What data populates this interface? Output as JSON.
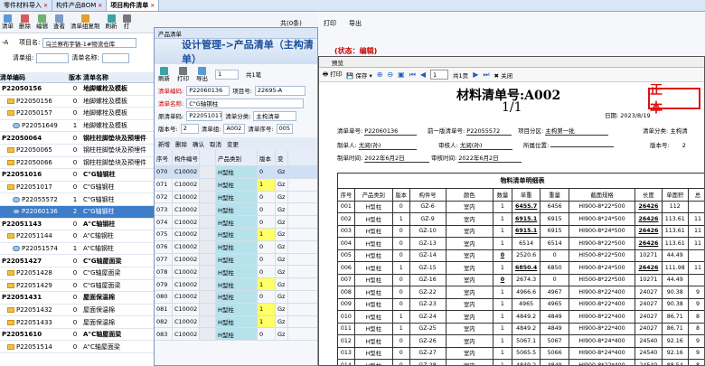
{
  "tabs": [
    {
      "label": "零件材料导入"
    },
    {
      "label": "构件产品BOM"
    },
    {
      "label": "项目构件清单"
    }
  ],
  "toolbar": {
    "items": [
      {
        "label": "清单"
      },
      {
        "label": "删除"
      },
      {
        "label": "编辑"
      },
      {
        "label": "查看"
      },
      {
        "label": "清单组复制"
      },
      {
        "label": "刷新"
      },
      {
        "label": "打"
      }
    ]
  },
  "top_right_text": {
    "a": "共(0条)",
    "b": "打印",
    "c": "导出",
    "d": "(状态：编辑)"
  },
  "filters": {
    "project_label": "项目名:",
    "project_value": "乌兰察布宇镐-1#物流仓库",
    "prefix": "-A",
    "list_group_label": "清单组:",
    "list_name_label": "清单名称:"
  },
  "tree": {
    "headers": [
      "清单编码",
      "版本",
      "清单名称"
    ],
    "rows": [
      {
        "code": "P22050156",
        "ver": "0",
        "name": "地脚螺栓及模板",
        "bold": true,
        "icon": "none"
      },
      {
        "code": "P22050156",
        "ver": "0",
        "name": "地脚螺栓及模板",
        "bold": false,
        "icon": "folder"
      },
      {
        "code": "P22050157",
        "ver": "0",
        "name": "地脚螺栓及模板",
        "bold": false,
        "icon": "folder"
      },
      {
        "code": "P22051649",
        "ver": "1",
        "name": "地脚螺栓及模板",
        "bold": false,
        "icon": "doc"
      },
      {
        "code": "P22050064",
        "ver": "0",
        "name": "钢柱柱脚垫块及预埋件",
        "bold": true,
        "icon": "none"
      },
      {
        "code": "P22050065",
        "ver": "0",
        "name": "钢柱柱脚垫块及预埋件",
        "bold": false,
        "icon": "folder"
      },
      {
        "code": "P22050066",
        "ver": "0",
        "name": "钢柱柱脚垫块及预埋件",
        "bold": false,
        "icon": "folder"
      },
      {
        "code": "P22051016",
        "ver": "0",
        "name": "C\"G轴钢柱",
        "bold": true,
        "icon": "none"
      },
      {
        "code": "P22051017",
        "ver": "0",
        "name": "C\"G轴钢柱",
        "bold": false,
        "icon": "folder"
      },
      {
        "code": "P22055572",
        "ver": "1",
        "name": "C\"G轴钢柱",
        "bold": false,
        "icon": "doc"
      },
      {
        "code": "P22060136",
        "ver": "2",
        "name": "C\"G轴钢柱",
        "bold": false,
        "icon": "doc",
        "selected": true
      },
      {
        "code": "P22051143",
        "ver": "0",
        "name": "A\"C轴钢柱",
        "bold": true,
        "icon": "none"
      },
      {
        "code": "P22051144",
        "ver": "0",
        "name": "A\"C轴钢柱",
        "bold": false,
        "icon": "folder"
      },
      {
        "code": "P22051574",
        "ver": "1",
        "name": "A\"C轴钢柱",
        "bold": false,
        "icon": "doc"
      },
      {
        "code": "P22051427",
        "ver": "0",
        "name": "C\"G轴屋面梁",
        "bold": true,
        "icon": "none"
      },
      {
        "code": "P22051428",
        "ver": "0",
        "name": "C\"G轴屋面梁",
        "bold": false,
        "icon": "folder"
      },
      {
        "code": "P22051429",
        "ver": "0",
        "name": "C\"G轴屋面梁",
        "bold": false,
        "icon": "folder"
      },
      {
        "code": "P22051431",
        "ver": "0",
        "name": "屋面保温棉",
        "bold": true,
        "icon": "none"
      },
      {
        "code": "P22051432",
        "ver": "0",
        "name": "屋面保温棉",
        "bold": false,
        "icon": "folder"
      },
      {
        "code": "P22051433",
        "ver": "0",
        "name": "屋面保温棉",
        "bold": false,
        "icon": "folder"
      },
      {
        "code": "P22051610",
        "ver": "0",
        "name": "A\"C轴屋面梁",
        "bold": true,
        "icon": "none"
      },
      {
        "code": "P22051514",
        "ver": "0",
        "name": "A\"C轴屋面梁",
        "bold": false,
        "icon": "folder"
      }
    ]
  },
  "mid": {
    "window_title": "产品清单",
    "heading": "设计管理->产品清单（主构清单）",
    "toolbar": {
      "refresh": "刷新",
      "print": "打印",
      "export": "导出",
      "page": "1",
      "total": "共1笔",
      "next": "浏览"
    },
    "fields": {
      "list_code_label": "清单编码:",
      "list_code": "P22060136",
      "project_label": "项目号:",
      "project": "22695-A",
      "list_name_label": "清单名称:",
      "list_name": "C\"G轴钢柱",
      "orig_label": "原清单码:",
      "orig": "P22051017",
      "cls_label": "清单分类:",
      "cls": "主构清单",
      "ver_label": "版本号:",
      "ver": "2",
      "group_label": "清单组:",
      "group": "A002",
      "seq_label": "清单序号:",
      "seq": "005"
    },
    "actions": [
      "新增",
      "删除",
      "确认",
      "取消",
      "变更"
    ],
    "grid_headers": [
      "序号",
      "构件编号",
      "产品类别",
      "版本",
      "变"
    ],
    "rows": [
      {
        "seq": "070",
        "code": "C10002",
        "cat": "H型柱",
        "ver": "0",
        "flag": "Gz"
      },
      {
        "seq": "071",
        "code": "C10002",
        "cat": "H型柱",
        "ver": "1",
        "flag": "Gz"
      },
      {
        "seq": "072",
        "code": "C10002",
        "cat": "H型柱",
        "ver": "0",
        "flag": "Gz"
      },
      {
        "seq": "073",
        "code": "C10002",
        "cat": "H型柱",
        "ver": "0",
        "flag": "Gz"
      },
      {
        "seq": "074",
        "code": "C10002",
        "cat": "H型柱",
        "ver": "0",
        "flag": "Gz"
      },
      {
        "seq": "075",
        "code": "C10002",
        "cat": "H型柱",
        "ver": "1",
        "flag": "Gz"
      },
      {
        "seq": "076",
        "code": "C10002",
        "cat": "H型柱",
        "ver": "0",
        "flag": "Gz"
      },
      {
        "seq": "077",
        "code": "C10002",
        "cat": "H型柱",
        "ver": "0",
        "flag": "Gz"
      },
      {
        "seq": "078",
        "code": "C10002",
        "cat": "H型柱",
        "ver": "0",
        "flag": "Gz"
      },
      {
        "seq": "079",
        "code": "C10002",
        "cat": "H型柱",
        "ver": "1",
        "flag": "Gz"
      },
      {
        "seq": "080",
        "code": "C10002",
        "cat": "H型柱",
        "ver": "0",
        "flag": "Gz"
      },
      {
        "seq": "081",
        "code": "C10002",
        "cat": "H型柱",
        "ver": "1",
        "flag": "Gz"
      },
      {
        "seq": "082",
        "code": "C10002",
        "cat": "H型柱",
        "ver": "1",
        "flag": "Gz"
      },
      {
        "seq": "083",
        "code": "C10002",
        "cat": "H型柱",
        "ver": "0",
        "flag": "Gz"
      }
    ]
  },
  "preview": {
    "window_title": "预览",
    "toolbar": {
      "print": "打印",
      "save": "保存",
      "page": "1",
      "total": "共1页",
      "close": "关闭"
    },
    "title": "材料清单号:A002",
    "page": "1/1",
    "stamp": "正 本",
    "date_label": "日期:",
    "date": "2023/8/19",
    "info": {
      "list_no_label": "清单单号:",
      "list_no": "P22060136",
      "prev_label": "前一版清单号:",
      "prev": "P22055572",
      "zone_label": "项目分区:",
      "zone": "主构第一批",
      "cls_label": "清单分类:",
      "cls": "主构清",
      "maker_label": "制单人:",
      "maker": "尤阅(孙)",
      "reviewer_label": "审核人:",
      "reviewer": "尤阅(孙)",
      "location_label": "所属位置:",
      "ver_label": "版本号:",
      "ver": "2",
      "made_time_label": "制单时间:",
      "made_time": "2022年6月2日",
      "review_time_label": "审核时间:",
      "review_time": "2022年6月2日"
    },
    "section": "物料清单明细表",
    "headers": [
      "序号",
      "产品类别",
      "版本",
      "构件号",
      "颜色",
      "数量",
      "单重",
      "重量",
      "截面规格",
      "长度",
      "单面积",
      "总"
    ],
    "rows": [
      {
        "n": "001",
        "cat": "H型柱",
        "ver": "0",
        "code": "GZ-6",
        "color": "室内",
        "qty": "1",
        "uw": "6455.7",
        "w": "6456",
        "spec": "HI900-8*22*500",
        "len": "26426",
        "area": "112",
        "t": "",
        "uwb": true,
        "lenb": true,
        "qtyb": false
      },
      {
        "n": "002",
        "cat": "H型柱",
        "ver": "1",
        "code": "GZ-9",
        "color": "室内",
        "qty": "1",
        "uw": "6915.1",
        "w": "6915",
        "spec": "HI900-8*24*500",
        "len": "26426",
        "area": "113.61",
        "t": "11",
        "uwb": true,
        "lenb": true,
        "qtyb": false
      },
      {
        "n": "003",
        "cat": "H型柱",
        "ver": "0",
        "code": "GZ-10",
        "color": "室内",
        "qty": "1",
        "uw": "6915.1",
        "w": "6915",
        "spec": "HI900-8*24*500",
        "len": "26426",
        "area": "113.61",
        "t": "11",
        "uwb": true,
        "lenb": true,
        "qtyb": false
      },
      {
        "n": "004",
        "cat": "H型柱",
        "ver": "0",
        "code": "GZ-13",
        "color": "室内",
        "qty": "1",
        "uw": "6514",
        "w": "6514",
        "spec": "HI900-8*22*500",
        "len": "26426",
        "area": "113.61",
        "t": "11",
        "uwb": false,
        "lenb": true,
        "qtyb": false
      },
      {
        "n": "005",
        "cat": "H型柱",
        "ver": "0",
        "code": "GZ-14",
        "color": "室内",
        "qty": "0",
        "uw": "2520.6",
        "w": "0",
        "spec": "HI500-8*22*500",
        "len": "10271",
        "area": "44.49",
        "t": "",
        "uwb": false,
        "lenb": false,
        "qtyb": true
      },
      {
        "n": "006",
        "cat": "H型柱",
        "ver": "1",
        "code": "GZ-15",
        "color": "室内",
        "qty": "1",
        "uw": "6850.4",
        "w": "6850",
        "spec": "HI900-8*24*500",
        "len": "26426",
        "area": "111.98",
        "t": "11",
        "uwb": true,
        "lenb": true,
        "qtyb": false
      },
      {
        "n": "007",
        "cat": "H型柱",
        "ver": "0",
        "code": "GZ-16",
        "color": "室内",
        "qty": "0",
        "uw": "2674.3",
        "w": "0",
        "spec": "HI500-8*22*500",
        "len": "10271",
        "area": "44.49",
        "t": "",
        "uwb": false,
        "lenb": false,
        "qtyb": true
      },
      {
        "n": "008",
        "cat": "H型柱",
        "ver": "0",
        "code": "GZ-22",
        "color": "室内",
        "qty": "1",
        "uw": "4966.6",
        "w": "4967",
        "spec": "HI900-8*22*400",
        "len": "24027",
        "area": "90.38",
        "t": "9",
        "uwb": false,
        "lenb": false,
        "qtyb": false
      },
      {
        "n": "009",
        "cat": "H型柱",
        "ver": "0",
        "code": "GZ-23",
        "color": "室内",
        "qty": "1",
        "uw": "4965",
        "w": "4965",
        "spec": "HI900-8*22*400",
        "len": "24027",
        "area": "90.38",
        "t": "9",
        "uwb": false,
        "lenb": false,
        "qtyb": false
      },
      {
        "n": "010",
        "cat": "H型柱",
        "ver": "1",
        "code": "GZ-24",
        "color": "室内",
        "qty": "1",
        "uw": "4849.2",
        "w": "4849",
        "spec": "HI900-8*22*400",
        "len": "24027",
        "area": "86.71",
        "t": "8",
        "uwb": false,
        "lenb": false,
        "qtyb": false
      },
      {
        "n": "011",
        "cat": "H型柱",
        "ver": "1",
        "code": "GZ-25",
        "color": "室内",
        "qty": "1",
        "uw": "4849.2",
        "w": "4849",
        "spec": "HI900-8*22*400",
        "len": "24027",
        "area": "86.71",
        "t": "8",
        "uwb": false,
        "lenb": false,
        "qtyb": false
      },
      {
        "n": "012",
        "cat": "H型柱",
        "ver": "0",
        "code": "GZ-26",
        "color": "室内",
        "qty": "1",
        "uw": "5067.1",
        "w": "5067",
        "spec": "HI900-8*24*400",
        "len": "24540",
        "area": "92.16",
        "t": "9",
        "uwb": false,
        "lenb": false,
        "qtyb": false
      },
      {
        "n": "013",
        "cat": "H型柱",
        "ver": "0",
        "code": "GZ-27",
        "color": "室内",
        "qty": "1",
        "uw": "5065.5",
        "w": "5066",
        "spec": "HI900-8*24*400",
        "len": "24540",
        "area": "92.16",
        "t": "9",
        "uwb": false,
        "lenb": false,
        "qtyb": false
      },
      {
        "n": "014",
        "cat": "H型柱",
        "ver": "0",
        "code": "GZ-28",
        "color": "室内",
        "qty": "1",
        "uw": "4849.2",
        "w": "4849",
        "spec": "HI900-8*22*400",
        "len": "24540",
        "area": "88.54",
        "t": "8",
        "uwb": false,
        "lenb": false,
        "qtyb": false
      }
    ]
  },
  "colors": {
    "accent": "#1b4f9a",
    "selected": "#3c7cc8",
    "stamp": "#d11",
    "highlight": "#ffff66"
  }
}
